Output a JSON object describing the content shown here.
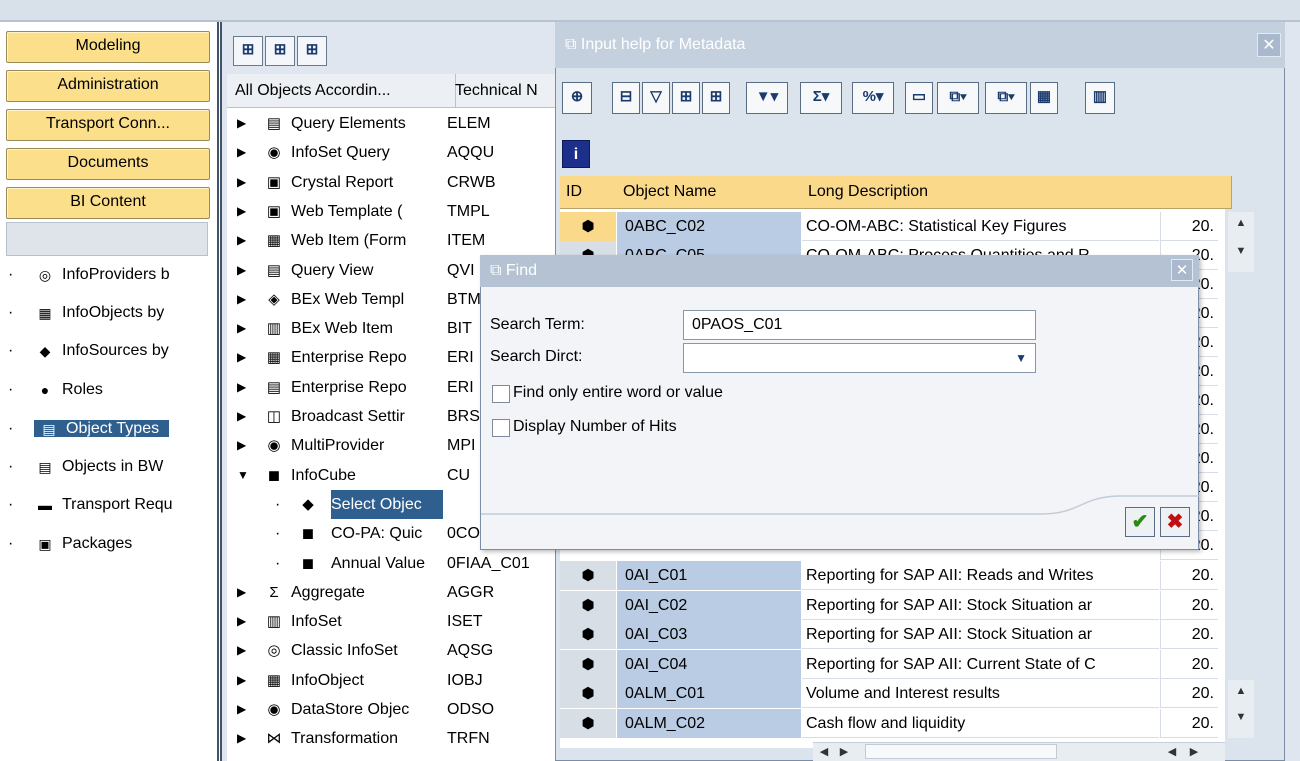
{
  "left_nav": {
    "buttons": [
      "Modeling",
      "Administration",
      "Transport Conn...",
      "Documents",
      "BI Content"
    ],
    "tree": [
      {
        "label": "InfoProviders b",
        "icon": "infoprovider-icon",
        "glyph": "◎"
      },
      {
        "label": "InfoObjects by",
        "icon": "infoobject-icon",
        "glyph": "▦"
      },
      {
        "label": "InfoSources by",
        "icon": "infosource-icon",
        "glyph": "◆"
      },
      {
        "label": "Roles",
        "icon": "roles-icon",
        "glyph": "●"
      },
      {
        "label": "Object Types",
        "icon": "document-icon",
        "glyph": "▤"
      },
      {
        "label": "Objects in BW",
        "icon": "document-icon",
        "glyph": "▤"
      },
      {
        "label": "Transport Requ",
        "icon": "truck-icon",
        "glyph": "▬"
      },
      {
        "label": "Packages",
        "icon": "package-icon",
        "glyph": "▣"
      }
    ]
  },
  "mid_toolbar": [
    "⊞",
    "ꟷ",
    "ꟷ"
  ],
  "mid_header": {
    "col1": "All Objects Accordin...",
    "col2": "Technical N"
  },
  "mid_tree": [
    {
      "name": "Query Elements",
      "code": "ELEM",
      "glyph": "▤",
      "arrow": "▶",
      "level": 0
    },
    {
      "name": "InfoSet Query",
      "code": "AQQU",
      "glyph": "◉",
      "arrow": "▶",
      "level": 0
    },
    {
      "name": "Crystal Report",
      "code": "CRWB",
      "glyph": "▣",
      "arrow": "▶",
      "level": 0
    },
    {
      "name": "Web Template (",
      "code": "TMPL",
      "glyph": "▣",
      "arrow": "▶",
      "level": 0
    },
    {
      "name": "Web Item (Form",
      "code": "ITEM",
      "glyph": "▦",
      "arrow": "▶",
      "level": 0
    },
    {
      "name": "Query View",
      "code": "QVI",
      "glyph": "▤",
      "arrow": "▶",
      "level": 0
    },
    {
      "name": "BEx Web Templ",
      "code": "BTM",
      "glyph": "◈",
      "arrow": "▶",
      "level": 0
    },
    {
      "name": "BEx Web Item",
      "code": "BIT",
      "glyph": "▥",
      "arrow": "▶",
      "level": 0
    },
    {
      "name": "Enterprise Repo",
      "code": "ERI",
      "glyph": "▦",
      "arrow": "▶",
      "level": 0
    },
    {
      "name": "Enterprise Repo",
      "code": "ERI",
      "glyph": "▤",
      "arrow": "▶",
      "level": 0
    },
    {
      "name": "Broadcast Settir",
      "code": "BRS",
      "glyph": "◫",
      "arrow": "▶",
      "level": 0
    },
    {
      "name": "MultiProvider",
      "code": "MPI",
      "glyph": "◉",
      "arrow": "▶",
      "level": 0
    },
    {
      "name": "InfoCube",
      "code": "CU",
      "glyph": "◼",
      "arrow": "▼",
      "level": 0
    },
    {
      "name": "Select Objec",
      "code": "",
      "glyph": "◆",
      "arrow": "",
      "level": 1,
      "selected": true
    },
    {
      "name": "CO-PA: Quic",
      "code": "0CO",
      "glyph": "◼",
      "arrow": "",
      "level": 1
    },
    {
      "name": "Annual Value",
      "code": "0FIAA_C01",
      "glyph": "◼",
      "arrow": "",
      "level": 1
    },
    {
      "name": "Aggregate",
      "code": "AGGR",
      "glyph": "Σ",
      "arrow": "▶",
      "level": 0
    },
    {
      "name": "InfoSet",
      "code": "ISET",
      "glyph": "▥",
      "arrow": "▶",
      "level": 0
    },
    {
      "name": "Classic InfoSet",
      "code": "AQSG",
      "glyph": "◎",
      "arrow": "▶",
      "level": 0
    },
    {
      "name": "InfoObject",
      "code": "IOBJ",
      "glyph": "▦",
      "arrow": "▶",
      "level": 0
    },
    {
      "name": "DataStore Objec",
      "code": "ODSO",
      "glyph": "◉",
      "arrow": "▶",
      "level": 0
    },
    {
      "name": "Transformation",
      "code": "TRFN",
      "glyph": "⋈",
      "arrow": "▶",
      "level": 0
    }
  ],
  "meta_window": {
    "title": "Input help for Metadata",
    "toolbar": [
      "⊕",
      "⊟",
      "▽",
      "⊞",
      "⊞",
      "▼▾",
      "Σ▾",
      "%▾",
      "▭",
      "⧉▾",
      "⧉▾",
      "▦",
      "▥"
    ],
    "info_label": "i",
    "columns": [
      "ID",
      "Object Name",
      "Long Description"
    ],
    "rows": [
      {
        "name": "0ABC_C02",
        "desc": "CO-OM-ABC: Statistical Key Figures",
        "yr": "20."
      },
      {
        "name": "0ABC_C05",
        "desc": "CO-OM-ABC: Process Quantities and R",
        "yr": "20."
      },
      {
        "name": "",
        "desc": "",
        "yr": "20."
      },
      {
        "name": "",
        "desc": "",
        "yr": "20."
      },
      {
        "name": "",
        "desc": "",
        "yr": "20."
      },
      {
        "name": "",
        "desc": "",
        "yr": "20."
      },
      {
        "name": "",
        "desc": "",
        "yr": "20."
      },
      {
        "name": "",
        "desc": "",
        "yr": "20."
      },
      {
        "name": "",
        "desc": "",
        "yr": "20."
      },
      {
        "name": "",
        "desc": "",
        "yr": "20."
      },
      {
        "name": "",
        "desc": "",
        "yr": "20."
      },
      {
        "name": "",
        "desc": "",
        "yr": "20."
      },
      {
        "name": "0AI_C01",
        "desc": "Reporting for SAP AII: Reads and Writes",
        "yr": "20."
      },
      {
        "name": "0AI_C02",
        "desc": "Reporting for SAP AII: Stock Situation ar",
        "yr": "20."
      },
      {
        "name": "0AI_C03",
        "desc": "Reporting for SAP AII: Stock Situation ar",
        "yr": "20."
      },
      {
        "name": "0AI_C04",
        "desc": "Reporting for SAP AII: Current State of C",
        "yr": "20."
      },
      {
        "name": "0ALM_C01",
        "desc": "Volume and Interest results",
        "yr": "20."
      },
      {
        "name": "0ALM_C02",
        "desc": "Cash flow and liquidity",
        "yr": "20."
      }
    ]
  },
  "find_dialog": {
    "title": "Find",
    "search_term_label": "Search Term:",
    "search_term_value": "0PAOS_C01",
    "search_dirct_label": "Search Dirct:",
    "search_dirct_value": "",
    "opt1": "Find only entire word or value",
    "opt2": "Display Number of Hits"
  }
}
